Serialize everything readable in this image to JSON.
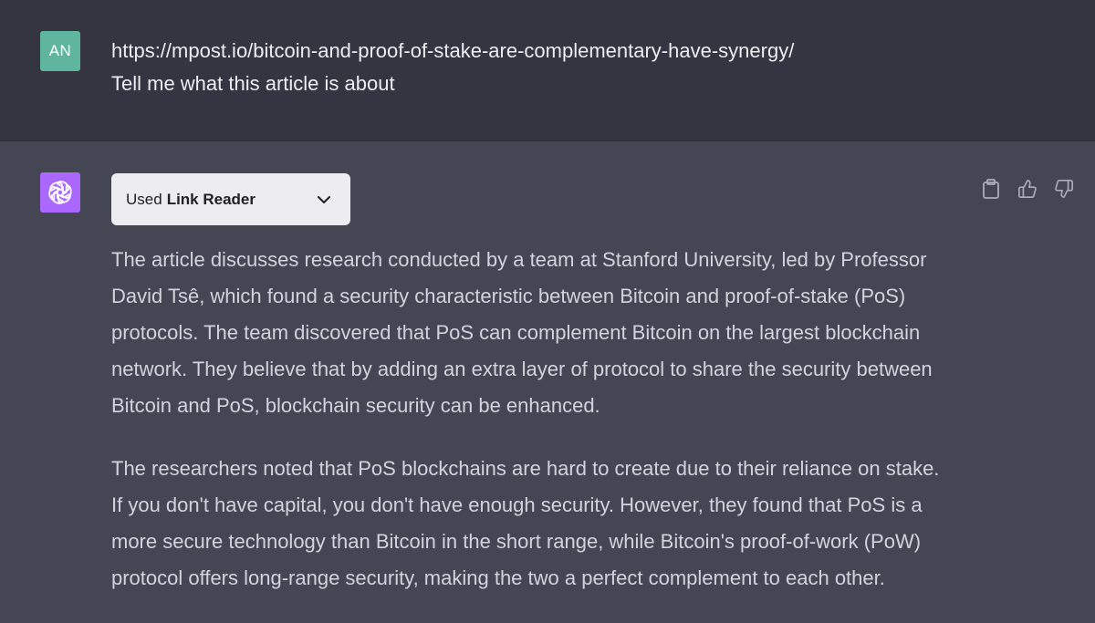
{
  "user_message": {
    "avatar_initials": "AN",
    "lines": [
      "https://mpost.io/bitcoin-and-proof-of-stake-are-complementary-have-synergy/",
      "Tell me what this article is about"
    ]
  },
  "assistant_message": {
    "avatar_icon": "openai-logo-icon",
    "plugin": {
      "used_label": "Used",
      "plugin_name": "Link Reader"
    },
    "actions": {
      "copy_icon": "clipboard-icon",
      "like_icon": "thumbs-up-icon",
      "dislike_icon": "thumbs-down-icon"
    },
    "paragraphs": [
      {
        "lines": [
          "The article discusses research conducted by a team at Stanford University, led by Professor",
          "David Tsê, which found a security characteristic between Bitcoin and proof-of-stake (PoS)",
          "protocols. The team discovered that PoS can complement Bitcoin on the largest blockchain",
          "network. They believe that by adding an extra layer of protocol to share the security between",
          "Bitcoin and PoS, blockchain security can be enhanced."
        ]
      },
      {
        "lines": [
          "The researchers noted that PoS blockchains are hard to create due to their reliance on stake.",
          "If you don't have capital, you don't have enough security. However, they found that PoS is a",
          "more secure technology than Bitcoin in the short range, while Bitcoin's proof-of-work (PoW)",
          "protocol offers long-range security, making the two a perfect complement to each other."
        ]
      }
    ]
  },
  "colors": {
    "user_bg": "#343541",
    "assistant_bg": "#444654",
    "user_avatar": "#5fb59e",
    "bot_avatar": "#ab68ff",
    "text": "#d1d5db"
  }
}
